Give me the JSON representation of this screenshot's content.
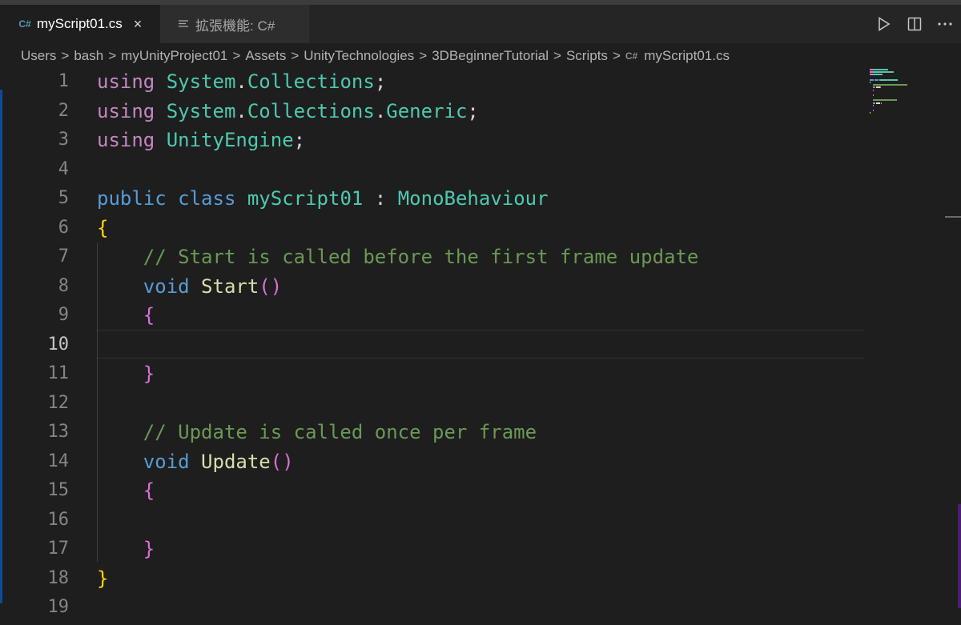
{
  "tabs": [
    {
      "icon": "C#",
      "label": "myScript01.cs",
      "close": "×"
    },
    {
      "label": "拡張機能: C#"
    }
  ],
  "breadcrumb": [
    "Users",
    "bash",
    "myUnityProject01",
    "Assets",
    "UnityTechnologies",
    "3DBeginnerTutorial",
    "Scripts",
    "myScript01.cs"
  ],
  "breadcrumb_separator": ">",
  "breadcrumb_file_icon": "C#",
  "editor": {
    "active_line": 10,
    "line_numbers": [
      "1",
      "2",
      "3",
      "4",
      "5",
      "6",
      "7",
      "8",
      "9",
      "10",
      "11",
      "12",
      "13",
      "14",
      "15",
      "16",
      "17",
      "18",
      "19"
    ],
    "lines": [
      [
        {
          "t": "using",
          "c": "kw-pink"
        },
        {
          "t": " "
        },
        {
          "t": "System",
          "c": "ns"
        },
        {
          "t": "."
        },
        {
          "t": "Collections",
          "c": "ns"
        },
        {
          "t": ";"
        }
      ],
      [
        {
          "t": "using",
          "c": "kw-pink"
        },
        {
          "t": " "
        },
        {
          "t": "System",
          "c": "ns"
        },
        {
          "t": "."
        },
        {
          "t": "Collections",
          "c": "ns"
        },
        {
          "t": "."
        },
        {
          "t": "Generic",
          "c": "ns"
        },
        {
          "t": ";"
        }
      ],
      [
        {
          "t": "using",
          "c": "kw-pink"
        },
        {
          "t": " "
        },
        {
          "t": "UnityEngine",
          "c": "ns"
        },
        {
          "t": ";"
        }
      ],
      [],
      [
        {
          "t": "public",
          "c": "kw-blue"
        },
        {
          "t": " "
        },
        {
          "t": "class",
          "c": "kw-blue"
        },
        {
          "t": " "
        },
        {
          "t": "myScript01",
          "c": "type"
        },
        {
          "t": " : "
        },
        {
          "t": "MonoBehaviour",
          "c": "type"
        }
      ],
      [
        {
          "t": "{",
          "c": "brace1"
        }
      ],
      [
        {
          "t": "    "
        },
        {
          "t": "// Start is called before the first frame update",
          "c": "comment"
        }
      ],
      [
        {
          "t": "    "
        },
        {
          "t": "void",
          "c": "kw-blue"
        },
        {
          "t": " "
        },
        {
          "t": "Start",
          "c": "func"
        },
        {
          "t": "()",
          "c": "brace2"
        }
      ],
      [
        {
          "t": "    "
        },
        {
          "t": "{",
          "c": "brace2"
        }
      ],
      [],
      [
        {
          "t": "    "
        },
        {
          "t": "}",
          "c": "brace2"
        }
      ],
      [],
      [
        {
          "t": "    "
        },
        {
          "t": "// Update is called once per frame",
          "c": "comment"
        }
      ],
      [
        {
          "t": "    "
        },
        {
          "t": "void",
          "c": "kw-blue"
        },
        {
          "t": " "
        },
        {
          "t": "Update",
          "c": "func"
        },
        {
          "t": "()",
          "c": "brace2"
        }
      ],
      [
        {
          "t": "    "
        },
        {
          "t": "{",
          "c": "brace2"
        }
      ],
      [],
      [
        {
          "t": "    "
        },
        {
          "t": "}",
          "c": "brace2"
        }
      ],
      [
        {
          "t": "}",
          "c": "brace1"
        }
      ],
      []
    ]
  },
  "actions": [
    "run-icon",
    "split-editor-icon",
    "more-icon"
  ],
  "colors": {
    "accent": "#0e4a9c",
    "tab_active_bg": "#1e1e1e",
    "editor_bg": "#1e1e1e"
  }
}
